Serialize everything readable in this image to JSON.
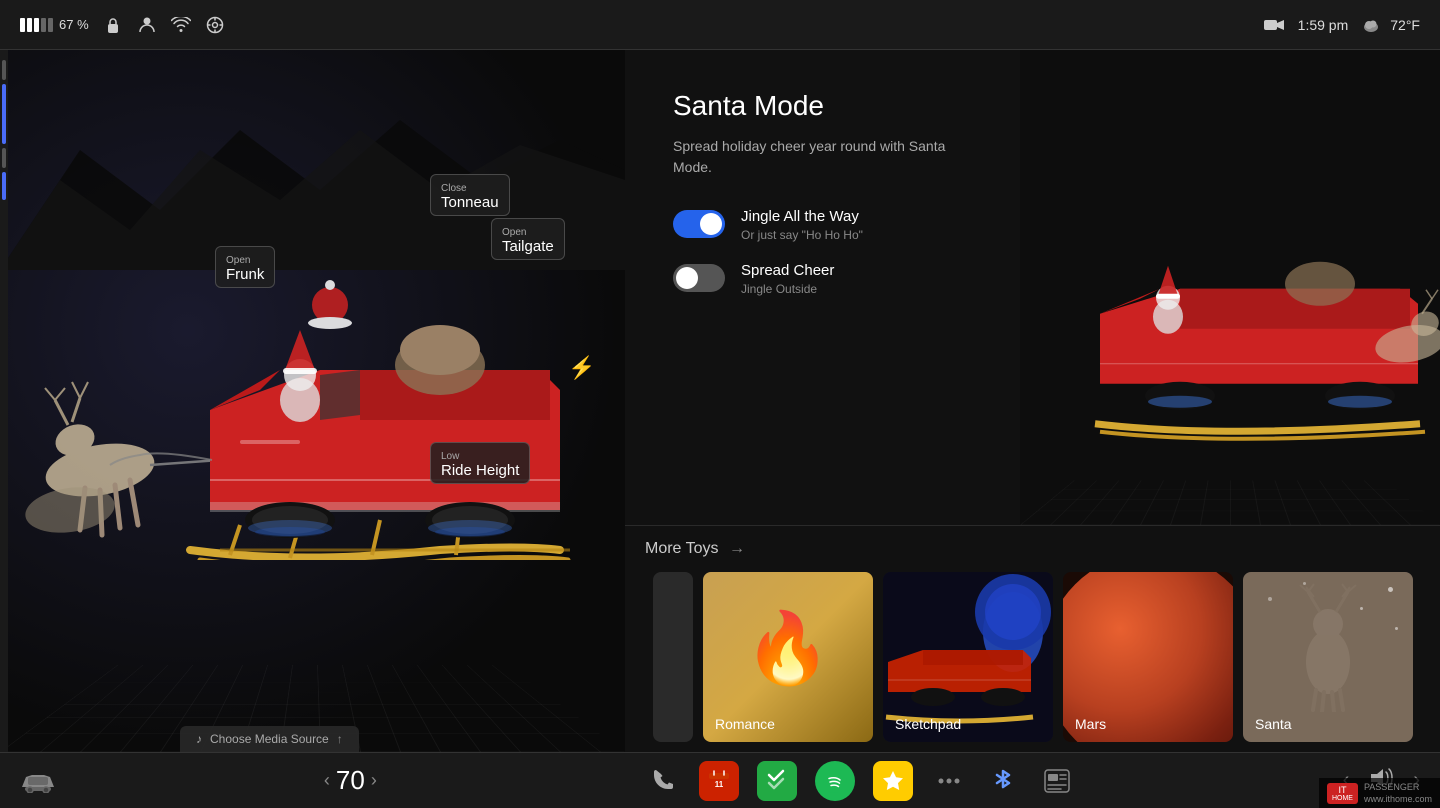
{
  "statusBar": {
    "battery": "67 %",
    "time": "1:59 pm",
    "weather": "72°F",
    "icons": {
      "lock": "🔒",
      "user": "👤",
      "wifi": "📶",
      "circle": "◎",
      "camera": "📷",
      "cloud": "☁"
    }
  },
  "leftPanel": {
    "labels": {
      "frunkSub": "Open",
      "frunkName": "Frunk",
      "tonneauSub": "Close",
      "tonneauName": "Tonneau",
      "tailgateSub": "Open",
      "tailgateName": "Tailgate",
      "rideSub": "Low",
      "rideName": "Ride Height"
    }
  },
  "rightPanel": {
    "santaMode": {
      "title": "Santa Mode",
      "description": "Spread holiday cheer year round with Santa Mode.",
      "toggles": [
        {
          "label": "Jingle All the Way",
          "sublabel": "Or just say \"Ho Ho Ho\"",
          "state": "on"
        },
        {
          "label": "Spread Cheer",
          "sublabel": "Jingle Outside",
          "state": "off"
        }
      ]
    },
    "moreToys": {
      "title": "More Toys",
      "arrow": "→",
      "toys": [
        {
          "id": "romance",
          "label": "Romance",
          "emoji": "🔥"
        },
        {
          "id": "sketchpad",
          "label": "Sketchpad",
          "emoji": ""
        },
        {
          "id": "mars",
          "label": "Mars",
          "emoji": ""
        },
        {
          "id": "santa",
          "label": "Santa",
          "emoji": ""
        }
      ]
    }
  },
  "taskbar": {
    "speed": "70",
    "mediaSource": "Choose Media Source",
    "apps": [
      {
        "name": "phone",
        "icon": "📞"
      },
      {
        "name": "calendar",
        "icon": "📅"
      },
      {
        "name": "tasks",
        "icon": "✅"
      },
      {
        "name": "spotify",
        "icon": "🎵"
      },
      {
        "name": "star",
        "icon": "⭐"
      },
      {
        "name": "dots",
        "icon": "⋯"
      },
      {
        "name": "bluetooth",
        "icon": "⚡"
      },
      {
        "name": "news",
        "icon": "📰"
      }
    ],
    "leftIcons": [
      {
        "name": "car",
        "icon": "🚗"
      }
    ],
    "rightNav": {
      "prev": "‹",
      "volume": "🔊",
      "next": "›"
    }
  },
  "watermark": {
    "badge": "PASSENGER",
    "site": "www.ithome.com"
  }
}
